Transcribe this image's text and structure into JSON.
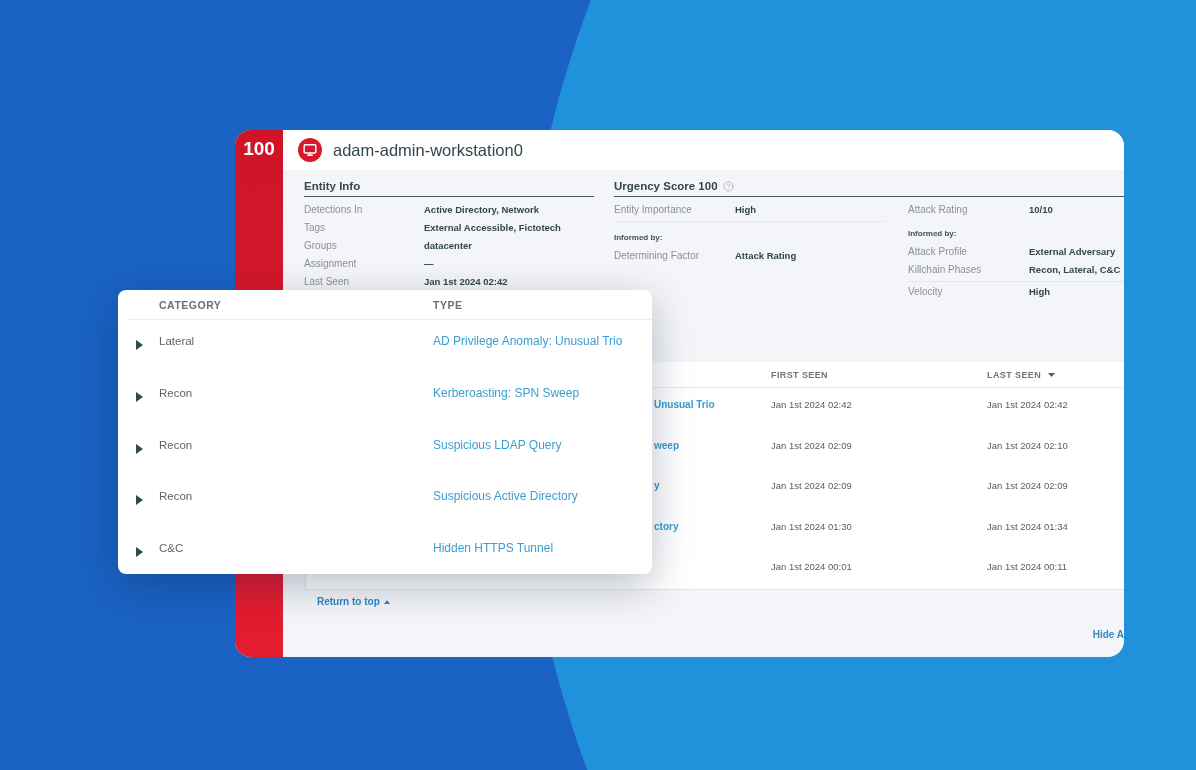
{
  "score_bar": {
    "score": "100"
  },
  "entity": {
    "title": "adam-admin-workstation0"
  },
  "entity_info": {
    "heading": "Entity Info",
    "rows": [
      {
        "label": "Detections In",
        "value": "Active Directory, Network"
      },
      {
        "label": "Tags",
        "value": "External Accessible, Fictotech"
      },
      {
        "label": "Groups",
        "value": "datacenter"
      },
      {
        "label": "Assignment",
        "value": "—"
      },
      {
        "label": "Last Seen",
        "value": "Jan 1st 2024 02:42"
      }
    ]
  },
  "urgency": {
    "heading": "Urgency Score 100",
    "left": [
      {
        "kind": "field",
        "label": "Entity Importance",
        "value": "High",
        "ruled": true
      },
      {
        "kind": "note",
        "text": "Informed by:"
      },
      {
        "kind": "field",
        "label": "Determining Factor",
        "value": "Attack Rating",
        "ruled": false
      }
    ],
    "right": [
      {
        "kind": "field",
        "label": "Attack Rating",
        "value": "10/10",
        "ruled": false
      },
      {
        "kind": "note",
        "text": "Informed by:"
      },
      {
        "kind": "field",
        "label": "Attack Profile",
        "value": "External Adversary",
        "ruled": false
      },
      {
        "kind": "field",
        "label": "Killchain Phases",
        "value": "Recon, Lateral, C&C",
        "ruled": true
      },
      {
        "kind": "field",
        "label": "Velocity",
        "value": "High",
        "ruled": false
      }
    ]
  },
  "table": {
    "columns": [
      {
        "label": "FIRST SEEN",
        "sorted": false
      },
      {
        "label": "LAST SEEN",
        "sorted": true
      }
    ],
    "rows": [
      {
        "column_1": "Unusual Trio",
        "first_seen": "Jan 1st 2024 02:42",
        "last_seen": "Jan 1st 2024 02:42"
      },
      {
        "column_1": "weep",
        "first_seen": "Jan 1st 2024 02:09",
        "last_seen": "Jan 1st 2024 02:10"
      },
      {
        "column_1": "y",
        "first_seen": "Jan 1st 2024 02:09",
        "last_seen": "Jan 1st 2024 02:09"
      },
      {
        "column_1": "ctory",
        "first_seen": "Jan 1st 2024 01:30",
        "last_seen": "Jan 1st 2024 01:34"
      },
      {
        "first_seen": "Jan 1st 2024 00:01",
        "last_seen": "Jan 1st 2024 00:11"
      }
    ]
  },
  "footer": {
    "return_link": "Return to top",
    "hide_link": "Hide A"
  },
  "detections_popup": {
    "columns": [
      "CATEGORY",
      "TYPE"
    ],
    "rows": [
      {
        "category": "Lateral",
        "type": "AD Privilege Anomaly: Unusual Trio",
        "expanded": false
      },
      {
        "category": "Recon",
        "type": "Kerberoasting: SPN Sweep",
        "expanded": false
      },
      {
        "category": "Recon",
        "type": "Suspicious LDAP Query",
        "expanded": false
      },
      {
        "category": "Recon",
        "type": "Suspicious Active Directory",
        "expanded": false
      },
      {
        "category": "C&C",
        "type": "Hidden HTTPS Tunnel",
        "expanded": false
      }
    ]
  }
}
